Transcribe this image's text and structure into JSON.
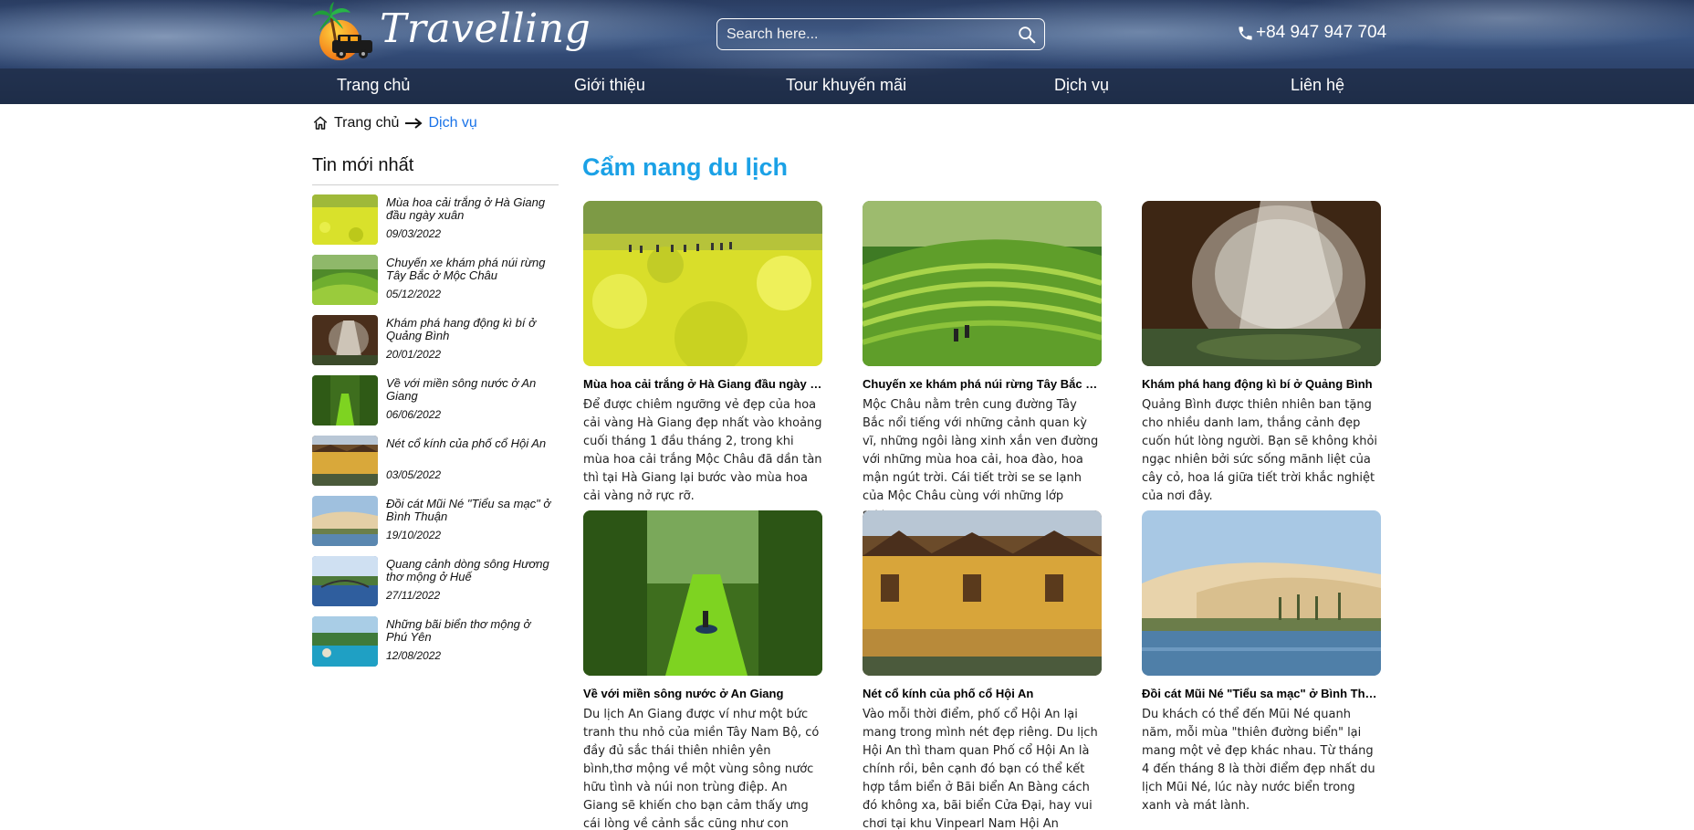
{
  "header": {
    "logo_text": "Travelling",
    "search_placeholder": "Search here...",
    "phone": "+84 947 947 704"
  },
  "nav": [
    {
      "label": "Trang chủ"
    },
    {
      "label": "Giới thiệu"
    },
    {
      "label": "Tour khuyến mãi"
    },
    {
      "label": "Dịch vụ"
    },
    {
      "label": "Liên hệ"
    }
  ],
  "breadcrumb": {
    "home": "Trang chủ",
    "current": "Dịch vụ"
  },
  "sidebar": {
    "title": "Tin mới nhất",
    "items": [
      {
        "title": "Mùa hoa cải trắng ở Hà Giang đầu ngày xuân",
        "date": "09/03/2022"
      },
      {
        "title": "Chuyến xe khám phá núi rừng Tây Bắc ở Mộc Châu",
        "date": "05/12/2022"
      },
      {
        "title": "Khám phá hang động kì bí ở Quảng Bình",
        "date": "20/01/2022"
      },
      {
        "title": "Về với miền sông nước ở An Giang",
        "date": "06/06/2022"
      },
      {
        "title": "Nét cổ kính của phố cổ Hội An",
        "date": "03/05/2022"
      },
      {
        "title": "Đồi cát Mũi Né \"Tiểu sa mạc\" ở Bình Thuận",
        "date": "19/10/2022"
      },
      {
        "title": "Quang cảnh dòng sông Hương thơ mộng ở Huế",
        "date": "27/11/2022"
      },
      {
        "title": "Những bãi biển thơ mộng ở Phú Yên",
        "date": "12/08/2022"
      }
    ]
  },
  "main": {
    "title": "Cẩm nang du lịch",
    "cards": [
      {
        "title": "Mùa hoa cải trắng ở Hà Giang đầu ngày xuân",
        "desc": "Để được chiêm ngưỡng vẻ đẹp của hoa cải vàng Hà Giang đẹp nhất vào khoảng cuối tháng 1 đầu tháng 2, trong khi mùa hoa cải trắng Mộc Châu đã dần tàn thì tại Hà Giang lại bước vào mùa hoa cải vàng nở rực rỡ."
      },
      {
        "title": "Chuyến xe khám phá núi rừng Tây Bắc ở Mộc Châu",
        "desc": "Mộc Châu nằm trên cung đường Tây Bắc nổi tiếng với những cảnh quan kỳ vĩ, những ngôi làng xinh xắn ven đường với những mùa hoa cải, hoa đào, hoa mận ngút trời. Cái tiết trời se se lạnh của Mộc Châu cùng với những lớp sương."
      },
      {
        "title": "Khám phá hang động kì bí ở Quảng Bình",
        "desc": "Quảng Bình được thiên nhiên ban tặng cho nhiều danh lam, thắng cảnh đẹp cuốn hút lòng người. Bạn sẽ không khỏi ngạc nhiên bởi sức sống mãnh liệt của cây cỏ, hoa lá giữa tiết trời khắc nghiệt của nơi đây."
      },
      {
        "title": "Về với miền sông nước ở An Giang",
        "desc": "Du lịch An Giang được ví như một bức tranh thu nhỏ của miền Tây Nam Bộ, có đầy đủ sắc thái thiên nhiên yên bình,thơ mộng về một vùng sông nước hữu tình và núi non trùng điệp. An Giang sẽ khiến cho bạn cảm thấy ưng cái lòng về cảnh sắc cũng như con người miền Tây."
      },
      {
        "title": "Nét cổ kính của phố cổ Hội An",
        "desc": "Vào mỗi thời điểm, phố cổ Hội An lại mang trong mình nét đẹp riêng. Du lịch Hội An thì tham quan Phố cổ Hội An là chính rồi, bên cạnh đó bạn có thể kết hợp tắm biển ở Bãi biển An Bàng cách đó không xa, bãi biển Cửa Đại, hay vui chơi tại khu Vinpearl Nam Hội An"
      },
      {
        "title": "Đồi cát Mũi Né \"Tiểu sa mạc\" ở Bình Thuận",
        "desc": "Du khách có thể đến Mũi Né quanh năm, mỗi mùa \"thiên đường biển\" lại mang một vẻ đẹp khác nhau. Từ tháng 4 đến tháng 8 là thời điểm đẹp nhất du lịch Mũi Né, lúc này nước biển trong xanh và mát lành."
      }
    ]
  }
}
